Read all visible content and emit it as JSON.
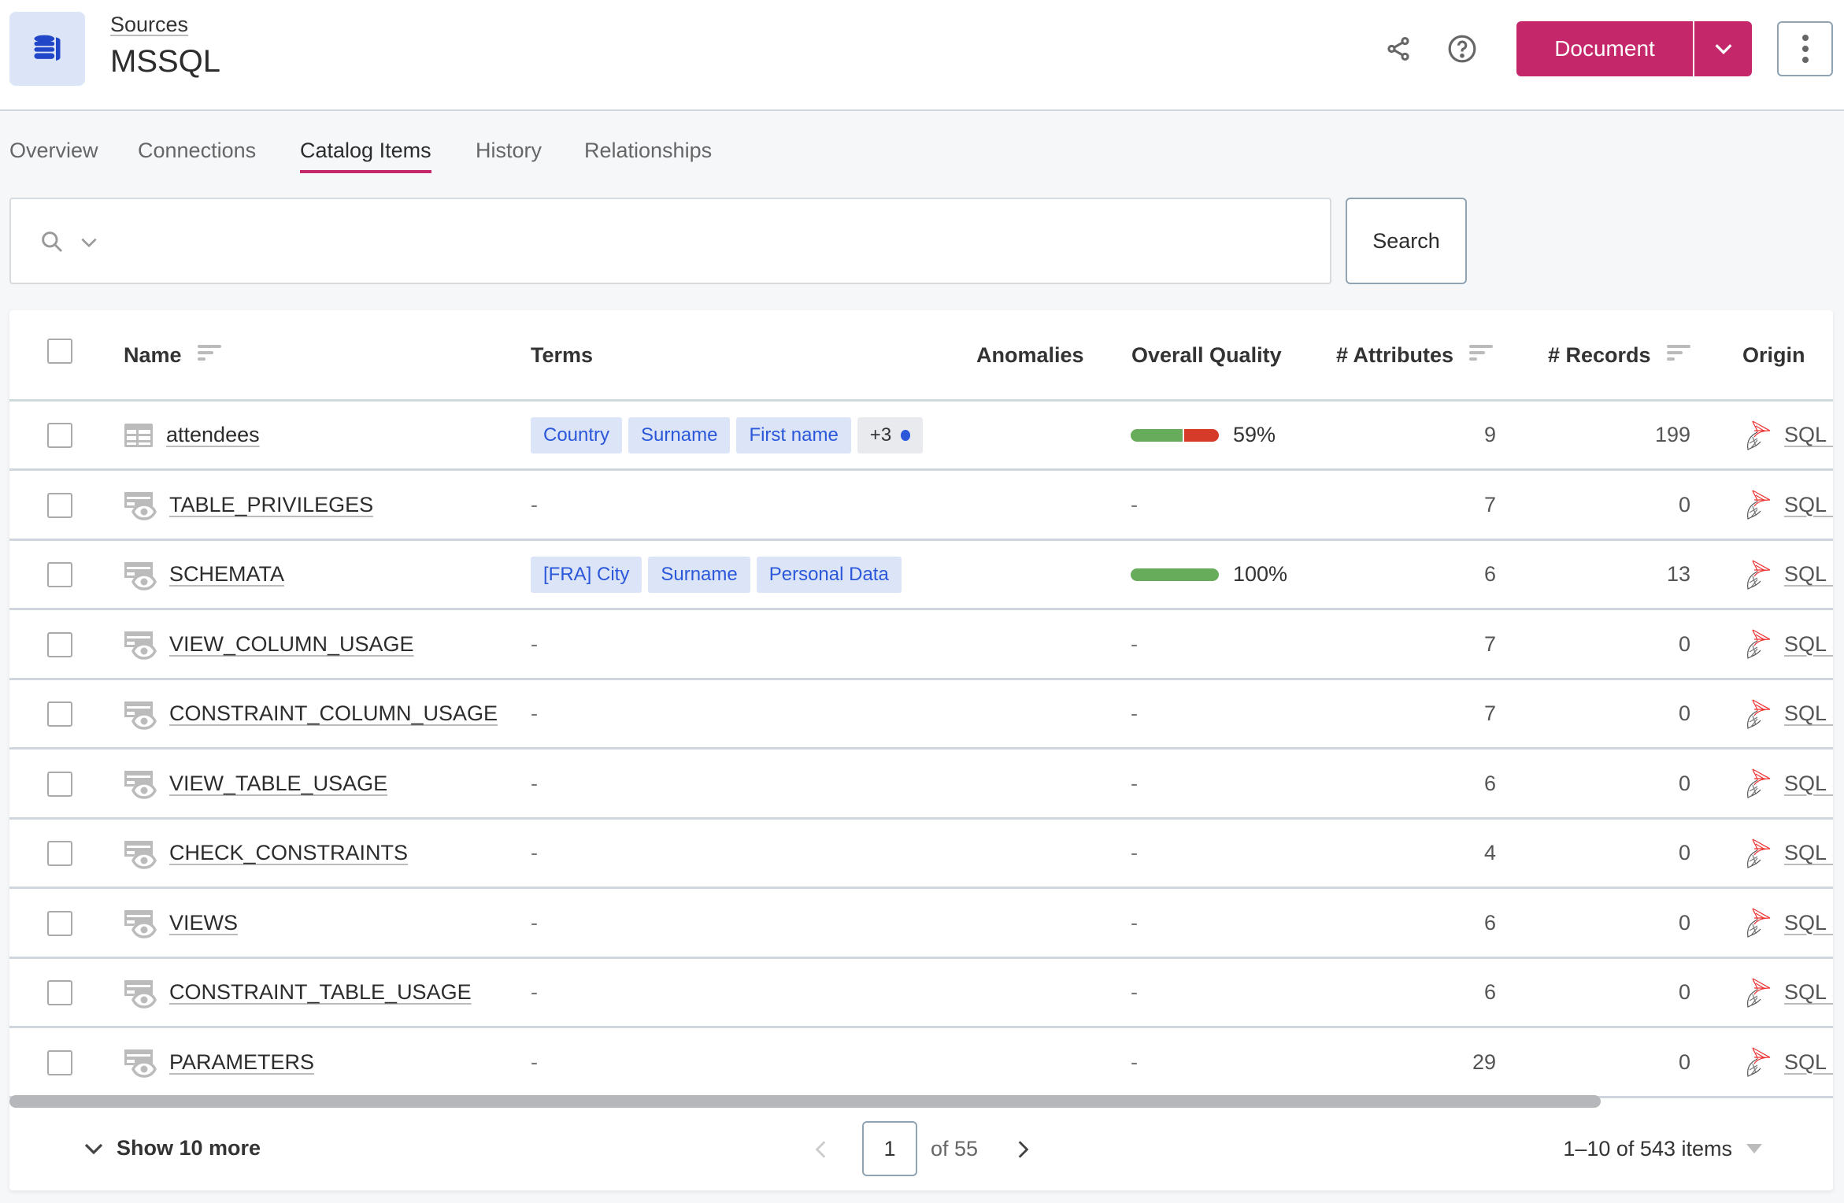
{
  "header": {
    "breadcrumb": "Sources",
    "title": "MSSQL",
    "logo_icon": "database-icon",
    "document_label": "Document",
    "accent": "#c4286a"
  },
  "tabs": [
    {
      "label": "Overview"
    },
    {
      "label": "Connections"
    },
    {
      "label": "Catalog Items",
      "active": true
    },
    {
      "label": "History"
    },
    {
      "label": "Relationships"
    }
  ],
  "search": {
    "value": "",
    "placeholder": "",
    "button": "Search"
  },
  "table": {
    "columns": [
      "Name",
      "Terms",
      "Anomalies",
      "Overall Quality",
      "# Attributes",
      "# Records",
      "Origin"
    ],
    "rows": [
      {
        "type": "table",
        "name": "attendees",
        "terms": [
          "Country",
          "Surname",
          "First name"
        ],
        "more_terms": "+3",
        "anomalies": "",
        "quality": 59,
        "quality_label": "59%",
        "attributes": "9",
        "records": "199",
        "origin": "SQL Server"
      },
      {
        "type": "view",
        "name": "TABLE_PRIVILEGES",
        "terms": [],
        "anomalies": "",
        "quality": null,
        "quality_label": "-",
        "attributes": "7",
        "records": "0",
        "origin": "SQL Server"
      },
      {
        "type": "view",
        "name": "SCHEMATA",
        "terms": [
          "[FRA] City",
          "Surname",
          "Personal Data"
        ],
        "anomalies": "",
        "quality": 100,
        "quality_label": "100%",
        "attributes": "6",
        "records": "13",
        "origin": "SQL Server"
      },
      {
        "type": "view",
        "name": "VIEW_COLUMN_USAGE",
        "terms": [],
        "anomalies": "",
        "quality": null,
        "quality_label": "-",
        "attributes": "7",
        "records": "0",
        "origin": "SQL Server"
      },
      {
        "type": "view",
        "name": "CONSTRAINT_COLUMN_USAGE",
        "terms": [],
        "anomalies": "",
        "quality": null,
        "quality_label": "-",
        "attributes": "7",
        "records": "0",
        "origin": "SQL Server"
      },
      {
        "type": "view",
        "name": "VIEW_TABLE_USAGE",
        "terms": [],
        "anomalies": "",
        "quality": null,
        "quality_label": "-",
        "attributes": "6",
        "records": "0",
        "origin": "SQL Server"
      },
      {
        "type": "view",
        "name": "CHECK_CONSTRAINTS",
        "terms": [],
        "anomalies": "",
        "quality": null,
        "quality_label": "-",
        "attributes": "4",
        "records": "0",
        "origin": "SQL Server"
      },
      {
        "type": "view",
        "name": "VIEWS",
        "terms": [],
        "anomalies": "",
        "quality": null,
        "quality_label": "-",
        "attributes": "6",
        "records": "0",
        "origin": "SQL Server"
      },
      {
        "type": "view",
        "name": "CONSTRAINT_TABLE_USAGE",
        "terms": [],
        "anomalies": "",
        "quality": null,
        "quality_label": "-",
        "attributes": "6",
        "records": "0",
        "origin": "SQL Server"
      },
      {
        "type": "view",
        "name": "PARAMETERS",
        "terms": [],
        "anomalies": "",
        "quality": null,
        "quality_label": "-",
        "attributes": "29",
        "records": "0",
        "origin": "SQL Server"
      }
    ]
  },
  "footer": {
    "show_more": "Show 10 more",
    "page": "1",
    "of_pages": "of 55",
    "range": "1–10 of 543 items"
  },
  "colors": {
    "quality_good": "#67ac5b",
    "quality_bad": "#d63b2a",
    "term_bg": "#dce4f8",
    "term_text": "#2b57d9"
  }
}
